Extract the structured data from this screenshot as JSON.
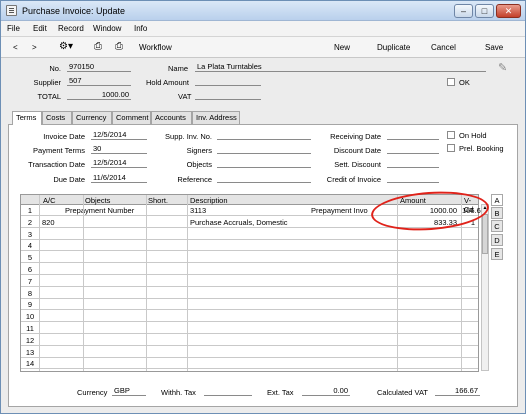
{
  "window": {
    "title": "Purchase Invoice: Update"
  },
  "menu": [
    "File",
    "Edit",
    "Record",
    "Window",
    "Info"
  ],
  "toolbar": {
    "prev": "<",
    "next": ">",
    "workflow": "Workflow",
    "new": "New",
    "duplicate": "Duplicate",
    "cancel": "Cancel",
    "save": "Save"
  },
  "header": {
    "no_label": "No.",
    "no_value": "970150",
    "name_label": "Name",
    "name_value": "La Plata Turntables",
    "supplier_label": "Supplier",
    "supplier_value": "507",
    "hold_label": "Hold Amount",
    "hold_value": "",
    "ok_label": "OK",
    "total_label": "TOTAL",
    "total_value": "1000.00",
    "vat_label": "VAT",
    "vat_value": ""
  },
  "tabs": [
    "Terms",
    "Costs",
    "Currency",
    "Comment",
    "Accounts",
    "Inv. Address"
  ],
  "terms": {
    "invoice_date_label": "Invoice Date",
    "invoice_date": "12/5/2014",
    "payment_terms_label": "Payment Terms",
    "payment_terms": "30",
    "transaction_date_label": "Transaction Date",
    "transaction_date": "12/5/2014",
    "due_date_label": "Due Date",
    "due_date": "11/6/2014",
    "supp_inv_label": "Supp. Inv. No.",
    "supp_inv": "",
    "signers_label": "Signers",
    "signers": "",
    "objects_label": "Objects",
    "objects": "",
    "reference_label": "Reference",
    "reference": "",
    "receiving_label": "Receiving Date",
    "receiving": "",
    "discount_date_label": "Discount Date",
    "discount_date": "",
    "sett_discount_label": "Sett. Discount",
    "sett_discount": "",
    "credit_label": "Credit of Invoice",
    "credit": "",
    "on_hold_label": "On Hold",
    "prel_booking_label": "Prel. Booking"
  },
  "grid": {
    "headers": [
      "A/C",
      "Objects",
      "Short.",
      "Description",
      "Amount",
      "V-Cd"
    ],
    "rows": [
      {
        "num": "1",
        "ac": "",
        "objects": "Prepayment Number",
        "short": "",
        "desc": "3113",
        "desc2": "Prepayment Invo",
        "amount": "1000.00",
        "vcd": "166.67"
      },
      {
        "num": "2",
        "ac": "820",
        "objects": "",
        "short": "",
        "desc": "Purchase Accruals, Domestic",
        "desc2": "",
        "amount": "833.33",
        "vcd": "1"
      },
      {
        "num": "3"
      },
      {
        "num": "4"
      },
      {
        "num": "5"
      },
      {
        "num": "6"
      },
      {
        "num": "7"
      },
      {
        "num": "8"
      },
      {
        "num": "9"
      },
      {
        "num": "10"
      },
      {
        "num": "11"
      },
      {
        "num": "12"
      },
      {
        "num": "13"
      },
      {
        "num": "14"
      }
    ]
  },
  "card_tabs": [
    "A",
    "B",
    "C",
    "D",
    "E"
  ],
  "footer": {
    "currency_label": "Currency",
    "currency": "GBP",
    "withh_tax_label": "Withh. Tax",
    "withh_tax": "",
    "ext_tax_label": "Ext. Tax",
    "ext_tax": "0.00",
    "calc_vat_label": "Calculated VAT",
    "calc_vat": "166.67"
  },
  "colors": {
    "highlight_ellipse": "#e0221a",
    "titlebar": "#b9d0ec"
  }
}
